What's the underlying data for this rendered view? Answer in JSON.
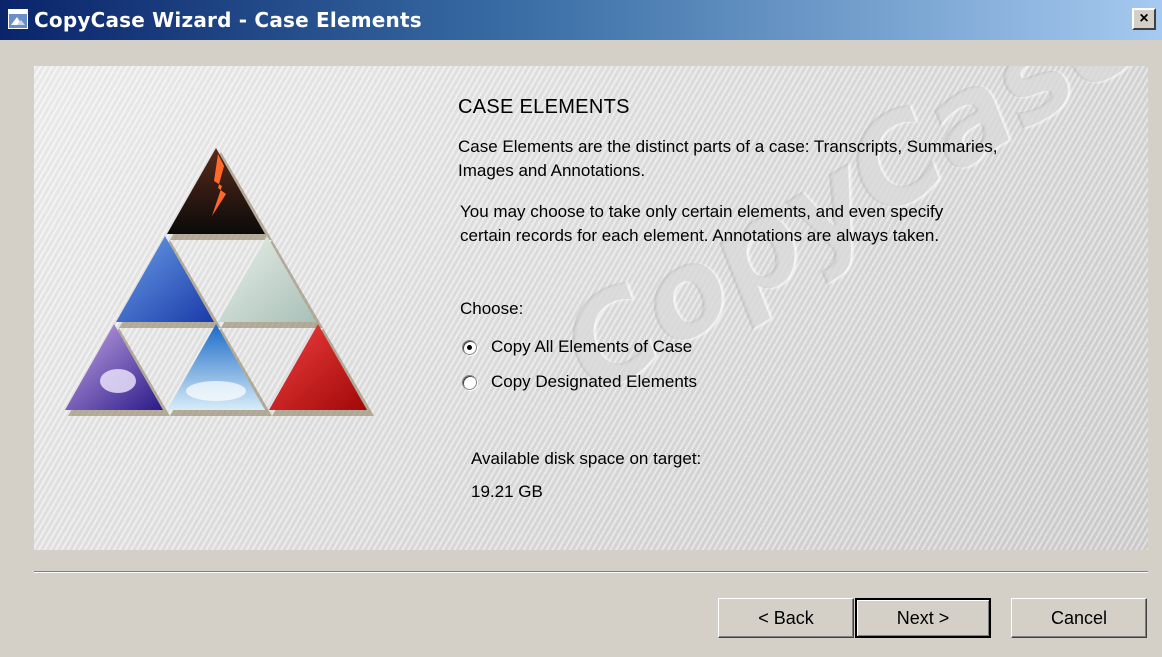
{
  "window": {
    "title": "CopyCase Wizard - Case Elements",
    "close_label": "×"
  },
  "watermark": "CopyCase",
  "content": {
    "heading": "CASE ELEMENTS",
    "description1_line1": "Case Elements are the distinct parts of a case:   Transcripts, Summaries,",
    "description1_line2": "Images and Annotations.",
    "description2_line1": "You may choose to take only certain elements, and even specify",
    "description2_line2": "certain records for each element.  Annotations are always taken.",
    "choose_label": "Choose:",
    "options": [
      {
        "label": "Copy All Elements of Case",
        "checked": true
      },
      {
        "label": "Copy Designated Elements",
        "checked": false
      }
    ],
    "disk_space_label": "Available disk space on target:",
    "disk_space_value": "19.21 GB"
  },
  "buttons": {
    "back": "< Back",
    "next": "Next >",
    "cancel": "Cancel"
  }
}
